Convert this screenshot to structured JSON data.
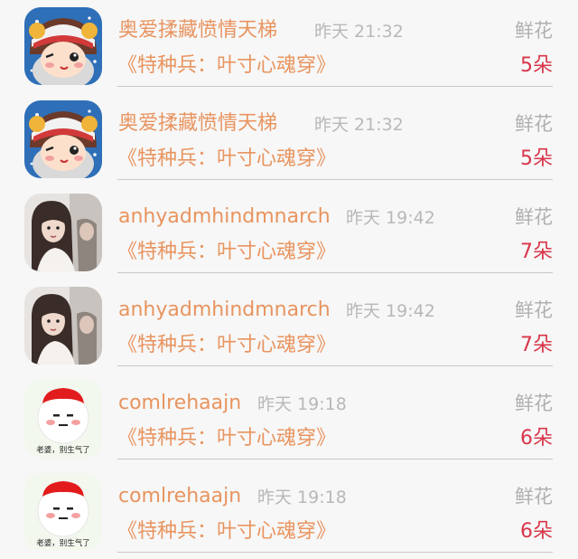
{
  "records": [
    {
      "user": "奥爱揉藏愤情天梯",
      "time": "昨天 21:32",
      "gift_label": "鲜花",
      "book": "《特种兵：叶寸心魂穿》",
      "count": "5朵",
      "avatar": "cartoon-girl"
    },
    {
      "user": "奥爱揉藏愤情天梯",
      "time": "昨天 21:32",
      "gift_label": "鲜花",
      "book": "《特种兵：叶寸心魂穿》",
      "count": "5朵",
      "avatar": "cartoon-girl"
    },
    {
      "user": "anhyadmhindmnarch",
      "time": "昨天 19:42",
      "gift_label": "鲜花",
      "book": "《特种兵：叶寸心魂穿》",
      "count": "7朵",
      "avatar": "photo-girl"
    },
    {
      "user": "anhyadmhindmnarch",
      "time": "昨天 19:42",
      "gift_label": "鲜花",
      "book": "《特种兵：叶寸心魂穿》",
      "count": "7朵",
      "avatar": "photo-girl"
    },
    {
      "user": "comlrehaajn",
      "time": "昨天 19:18",
      "gift_label": "鲜花",
      "book": "《特种兵：叶寸心魂穿》",
      "count": "6朵",
      "avatar": "meme-sticker",
      "avatar_caption": "老婆，别生气了"
    },
    {
      "user": "comlrehaajn",
      "time": "昨天 19:18",
      "gift_label": "鲜花",
      "book": "《特种兵：叶寸心魂穿》",
      "count": "6朵",
      "avatar": "meme-sticker",
      "avatar_caption": "老婆，别生气了"
    }
  ],
  "colors": {
    "accent": "#e8945f",
    "count": "#d9364a",
    "muted": "#b8b8b8",
    "divider": "#c8c8c8",
    "background": "#f7f7f7"
  }
}
